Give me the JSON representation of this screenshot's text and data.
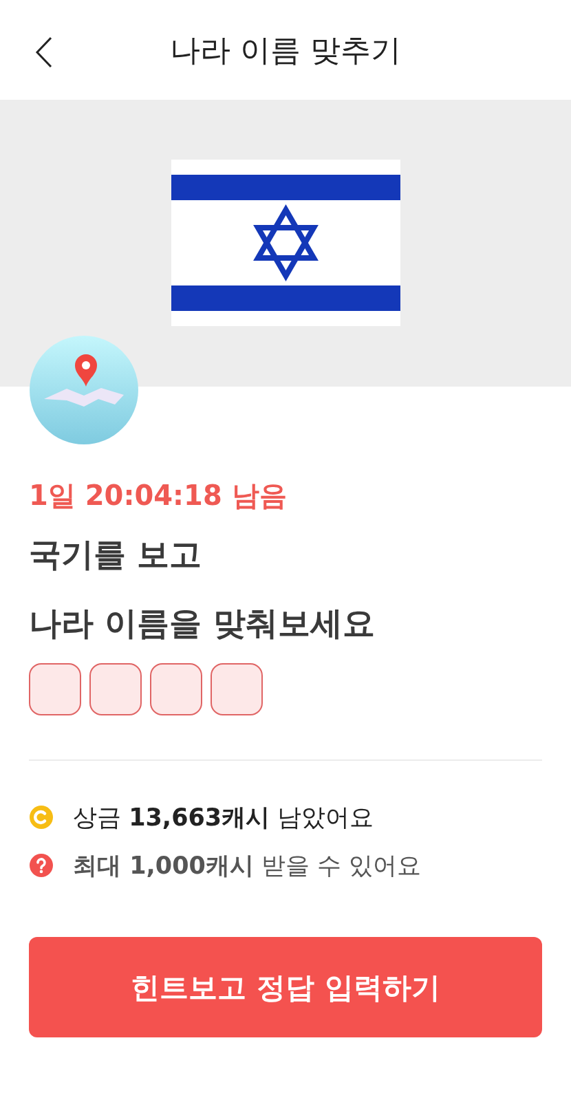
{
  "header": {
    "title": "나라 이름 맞추기"
  },
  "timer": "1일 20:04:18 남음",
  "question": [
    "국기를 보고",
    "나라 이름을 맞춰보세요"
  ],
  "answer_slots": [
    {
      "filled": false
    },
    {
      "filled": false
    },
    {
      "filled": false
    },
    {
      "filled": false
    }
  ],
  "info": [
    {
      "kind": "coin",
      "text": "상금 **13,663캐시** 남았어요"
    },
    {
      "kind": "question",
      "text": "**최대 1,000캐시** 받을 수 있어요"
    }
  ],
  "button": "힌트보고 정답 입력하기"
}
